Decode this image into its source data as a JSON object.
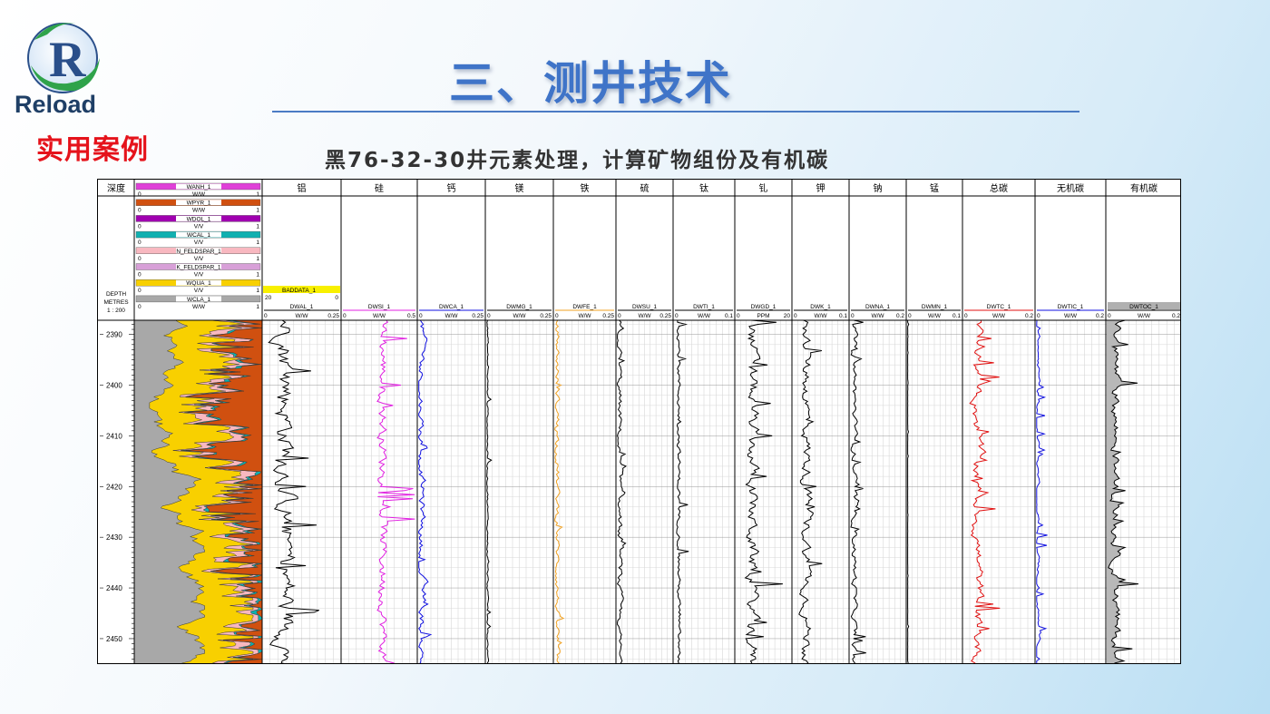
{
  "brand": {
    "logo_letter": "R",
    "name": "Reload",
    "tag": "实用案例"
  },
  "slide": {
    "title": "三、测井技术",
    "subtitle": "黑76-32-30井元素处理，计算矿物组份及有机碳"
  },
  "log": {
    "depth_header": "深度",
    "depth_unit_lines": [
      "DEPTH",
      "METRES",
      "1 : 200"
    ],
    "depth_ticks": [
      "2390",
      "2400",
      "2410",
      "2420",
      "2430",
      "2440",
      "2450"
    ],
    "mineral_legend": [
      {
        "name": "WANH_1",
        "unit": "W/W",
        "color": "#e040d8"
      },
      {
        "name": "WPYR_1",
        "unit": "W/W",
        "color": "#d05010"
      },
      {
        "name": "WDOL_1",
        "unit": "V/V",
        "color": "#a000b0"
      },
      {
        "name": "WCAL_1",
        "unit": "V/V",
        "color": "#10b0b0"
      },
      {
        "name": "N_FELDSPAR_1",
        "unit": "V/V",
        "color": "#f8b8c0"
      },
      {
        "name": "K_FELDSPAR_1",
        "unit": "V/V",
        "color": "#d8a0d8"
      },
      {
        "name": "WQUA_1",
        "unit": "V/V",
        "color": "#f8d000"
      },
      {
        "name": "WCLA_1",
        "unit": "W/W",
        "color": "#a8a8a8"
      }
    ],
    "baddata": {
      "name": "BADDATA_1",
      "min": "20",
      "max": "0"
    },
    "tracks": [
      {
        "title": "铝",
        "curve": "DWAL_1",
        "unit": "W/W",
        "min": "0",
        "max": "0.25",
        "color": "#000000"
      },
      {
        "title": "硅",
        "curve": "DWSI_1",
        "unit": "W/W",
        "min": "0",
        "max": "0.5",
        "color": "#e020e0"
      },
      {
        "title": "钙",
        "curve": "DWCA_1",
        "unit": "W/W",
        "min": "0",
        "max": "0.25",
        "color": "#1010e0"
      },
      {
        "title": "镁",
        "curve": "DWMG_1",
        "unit": "W/W",
        "min": "0",
        "max": "0.25",
        "color": "#000000"
      },
      {
        "title": "铁",
        "curve": "DWFE_1",
        "unit": "W/W",
        "min": "0",
        "max": "0.25",
        "color": "#f0a020"
      },
      {
        "title": "硫",
        "curve": "DWSU_1",
        "unit": "W/W",
        "min": "0",
        "max": "0.25",
        "color": "#000000"
      },
      {
        "title": "钛",
        "curve": "DWTI_1",
        "unit": "W/W",
        "min": "0",
        "max": "0.1",
        "color": "#000000"
      },
      {
        "title": "钆",
        "curve": "DWGD_1",
        "unit": "PPM",
        "min": "0",
        "max": "20",
        "color": "#000000"
      },
      {
        "title": "钾",
        "curve": "DWK_1",
        "unit": "W/W",
        "min": "0",
        "max": "0.1",
        "color": "#000000"
      },
      {
        "title": "钠",
        "curve": "DWNA_1",
        "unit": "W/W",
        "min": "0",
        "max": "0.2",
        "color": "#000000"
      },
      {
        "title": "锰",
        "curve": "DWMN_1",
        "unit": "W/W",
        "min": "0",
        "max": "0.1",
        "color": "#000000"
      },
      {
        "title": "总碳",
        "curve": "DWTC_1",
        "unit": "W/W",
        "min": "0",
        "max": "0.2",
        "color": "#e01010"
      },
      {
        "title": "无机碳",
        "curve": "DWTIC_1",
        "unit": "W/W",
        "min": "0",
        "max": "0.2",
        "color": "#1010e0"
      },
      {
        "title": "有机碳",
        "curve": "DWTOC_1",
        "unit": "W/W",
        "min": "0",
        "max": "0.2",
        "color": "#000000"
      }
    ]
  }
}
